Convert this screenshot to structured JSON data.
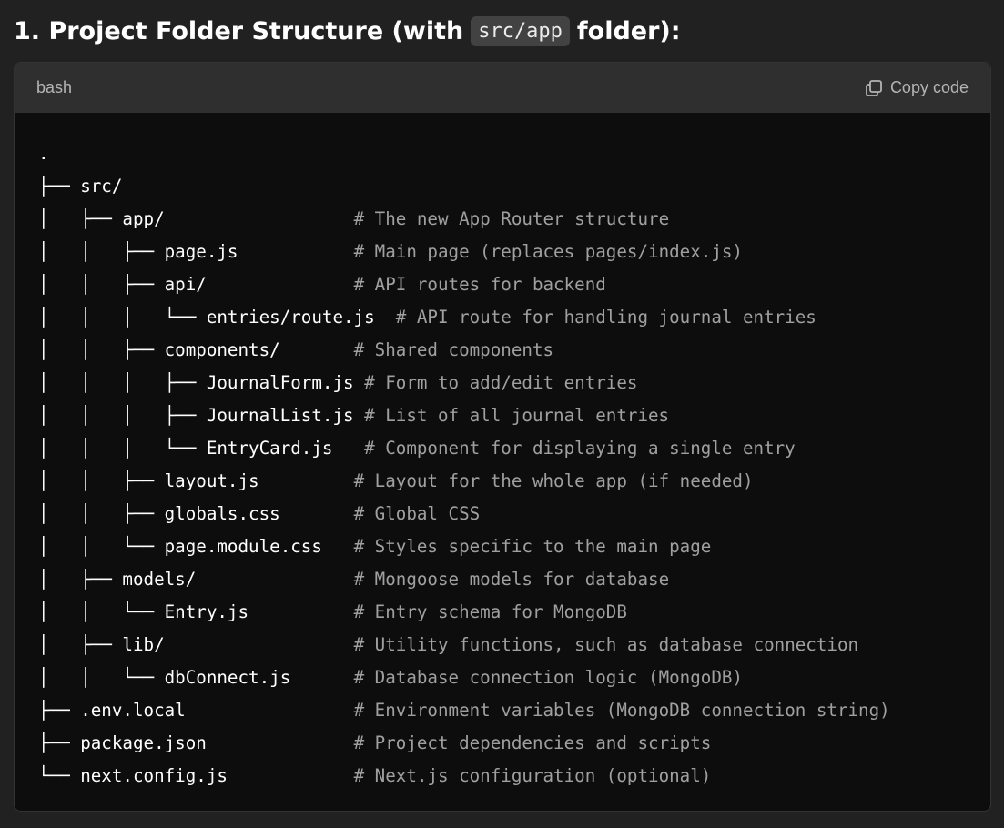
{
  "heading": {
    "prefix": "1. Project Folder Structure (with",
    "code": "src/app",
    "suffix": "folder):"
  },
  "code_block": {
    "language": "bash",
    "copy_label": "Copy code",
    "lines": [
      {
        "tree": ".",
        "comment": ""
      },
      {
        "tree": "├── src/",
        "comment": ""
      },
      {
        "tree": "│   ├── app/                  ",
        "comment": "# The new App Router structure"
      },
      {
        "tree": "│   │   ├── page.js           ",
        "comment": "# Main page (replaces pages/index.js)"
      },
      {
        "tree": "│   │   ├── api/              ",
        "comment": "# API routes for backend"
      },
      {
        "tree": "│   │   │   └── entries/route.js  ",
        "comment": "# API route for handling journal entries"
      },
      {
        "tree": "│   │   ├── components/       ",
        "comment": "# Shared components"
      },
      {
        "tree": "│   │   │   ├── JournalForm.js ",
        "comment": "# Form to add/edit entries"
      },
      {
        "tree": "│   │   │   ├── JournalList.js ",
        "comment": "# List of all journal entries"
      },
      {
        "tree": "│   │   │   └── EntryCard.js   ",
        "comment": "# Component for displaying a single entry"
      },
      {
        "tree": "│   │   ├── layout.js         ",
        "comment": "# Layout for the whole app (if needed)"
      },
      {
        "tree": "│   │   ├── globals.css       ",
        "comment": "# Global CSS"
      },
      {
        "tree": "│   │   └── page.module.css   ",
        "comment": "# Styles specific to the main page"
      },
      {
        "tree": "│   ├── models/               ",
        "comment": "# Mongoose models for database"
      },
      {
        "tree": "│   │   └── Entry.js          ",
        "comment": "# Entry schema for MongoDB"
      },
      {
        "tree": "│   ├── lib/                  ",
        "comment": "# Utility functions, such as database connection"
      },
      {
        "tree": "│   │   └── dbConnect.js      ",
        "comment": "# Database connection logic (MongoDB)"
      },
      {
        "tree": "├── .env.local                ",
        "comment": "# Environment variables (MongoDB connection string)"
      },
      {
        "tree": "├── package.json              ",
        "comment": "# Project dependencies and scripts"
      },
      {
        "tree": "└── next.config.js            ",
        "comment": "# Next.js configuration (optional)"
      }
    ]
  },
  "icons": {
    "copy": "copy-icon"
  },
  "colors": {
    "page_background": "#212121",
    "code_background": "#0d0d0d",
    "header_background": "#2f2f2f",
    "comment": "#a0a0a0",
    "code_text": "#ffffff"
  }
}
